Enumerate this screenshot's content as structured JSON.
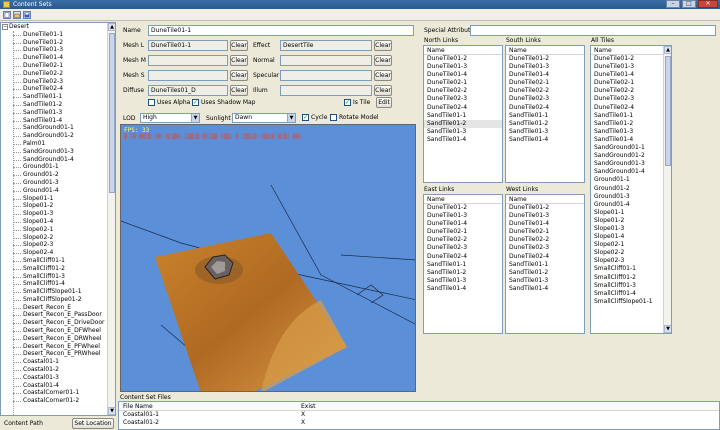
{
  "window": {
    "title": "Content Sets",
    "buttons": [
      "–",
      "□",
      "✕"
    ]
  },
  "tree": {
    "root": "Desert",
    "items": [
      "DuneTile01-1",
      "DuneTile01-2",
      "DuneTile01-3",
      "DuneTile01-4",
      "DuneTile02-1",
      "DuneTile02-2",
      "DuneTile02-3",
      "DuneTile02-4",
      "SandTile01-1",
      "SandTile01-2",
      "SandTile01-3",
      "SandTile01-4",
      "SandGround01-1",
      "SandGround01-2",
      "Palm01",
      "SandGround01-3",
      "SandGround01-4",
      "Ground01-1",
      "Ground01-2",
      "Ground01-3",
      "Ground01-4",
      "Slope01-1",
      "Slope01-2",
      "Slope01-3",
      "Slope01-4",
      "Slope02-1",
      "Slope02-2",
      "Slope02-3",
      "Slope02-4",
      "SmallCliff01-1",
      "SmallCliff01-2",
      "SmallCliff01-3",
      "SmallCliff01-4",
      "SmallCliffSlope01-1",
      "SmallCliffSlope01-2",
      "Desert_Recon_E",
      "Desert_Recon_E_PassDoor",
      "Desert_Recon_E_DriveDoor",
      "Desert_Recon_E_DFWheel",
      "Desert_Recon_E_DRWheel",
      "Desert_Recon_E_PFWheel",
      "Desert_Recon_E_PRWheel",
      "Coastal01-1",
      "Coastal01-2",
      "Coastal01-3",
      "Coastal01-4",
      "CoastalCorner01-1",
      "CoastalCorner01-2"
    ]
  },
  "bottom": {
    "content_path_label": "Content Path",
    "set_location": "Set Location"
  },
  "props": {
    "name_label": "Name",
    "name_value": "DuneTile01-1",
    "mesh_l_label": "Mesh L",
    "mesh_l_value": "DuneTile01-1",
    "mesh_m_label": "Mesh M",
    "mesh_m_value": "",
    "mesh_s_label": "Mesh S",
    "mesh_s_value": "",
    "diffuse_label": "Diffuse",
    "diffuse_value": "DuneTiles01_D",
    "effect_label": "Effect",
    "effect_value": "DesertTile",
    "normal_label": "Normal",
    "normal_value": "",
    "specular_label": "Specular",
    "specular_value": "",
    "illum_label": "Illum",
    "illum_value": "",
    "clear": "Clear",
    "uses_alpha": "Uses Alpha",
    "uses_shadow_map": "Uses Shadow Map",
    "is_tile": "Is Tile",
    "edit": "Edit",
    "lod_label": "LOD",
    "lod_value": "High",
    "sunlight_label": "Sunlight",
    "sunlight_value": "Dawn",
    "cycle": "Cycle",
    "rotate_model": "Rotate Model"
  },
  "viewport": {
    "fps": "FPS: 33"
  },
  "special": {
    "label": "Special Attribute",
    "value": ""
  },
  "links": {
    "col_header": "Name",
    "north": {
      "label": "North Links",
      "items": [
        "DuneTile01-2",
        "DuneTile01-3",
        "DuneTile01-4",
        "DuneTile02-1",
        "DuneTile02-2",
        "DuneTile02-3",
        "DuneTile02-4",
        "SandTile01-1",
        "SandTile01-2",
        "SandTile01-3",
        "SandTile01-4"
      ],
      "selected": 8
    },
    "south": {
      "label": "South Links",
      "items": [
        "DuneTile01-2",
        "DuneTile01-3",
        "DuneTile01-4",
        "DuneTile02-1",
        "DuneTile02-2",
        "DuneTile02-3",
        "DuneTile02-4",
        "SandTile01-1",
        "SandTile01-2",
        "SandTile01-3",
        "SandTile01-4"
      ]
    },
    "east": {
      "label": "East Links",
      "items": [
        "DuneTile01-2",
        "DuneTile01-3",
        "DuneTile01-4",
        "DuneTile02-1",
        "DuneTile02-2",
        "DuneTile02-3",
        "DuneTile02-4",
        "SandTile01-1",
        "SandTile01-2",
        "SandTile01-3",
        "SandTile01-4"
      ]
    },
    "west": {
      "label": "West Links",
      "items": [
        "DuneTile01-2",
        "DuneTile01-3",
        "DuneTile01-4",
        "DuneTile02-1",
        "DuneTile02-2",
        "DuneTile02-3",
        "DuneTile02-4",
        "SandTile01-1",
        "SandTile01-2",
        "SandTile01-3",
        "SandTile01-4"
      ]
    },
    "all": {
      "label": "All Tiles",
      "items": [
        "DuneTile01-2",
        "DuneTile01-3",
        "DuneTile01-4",
        "DuneTile02-1",
        "DuneTile02-2",
        "DuneTile02-3",
        "DuneTile02-4",
        "SandTile01-1",
        "SandTile01-2",
        "SandTile01-3",
        "SandTile01-4",
        "SandGround01-1",
        "SandGround01-2",
        "SandGround01-3",
        "SandGround01-4",
        "Ground01-1",
        "Ground01-2",
        "Ground01-3",
        "Ground01-4",
        "Slope01-1",
        "Slope01-2",
        "Slope01-3",
        "Slope01-4",
        "Slope02-1",
        "Slope02-2",
        "Slope02-3",
        "SmallCliff01-1",
        "SmallCliff01-2",
        "SmallCliff01-3",
        "SmallCliff01-4",
        "SmallCliffSlope01-1"
      ]
    }
  },
  "files": {
    "label": "Content Set Files",
    "col_name": "File Name",
    "col_exist": "Exist",
    "rows": [
      {
        "name": "Coastal01-1",
        "exist": "X"
      },
      {
        "name": "Coastal01-2",
        "exist": "X"
      }
    ]
  }
}
